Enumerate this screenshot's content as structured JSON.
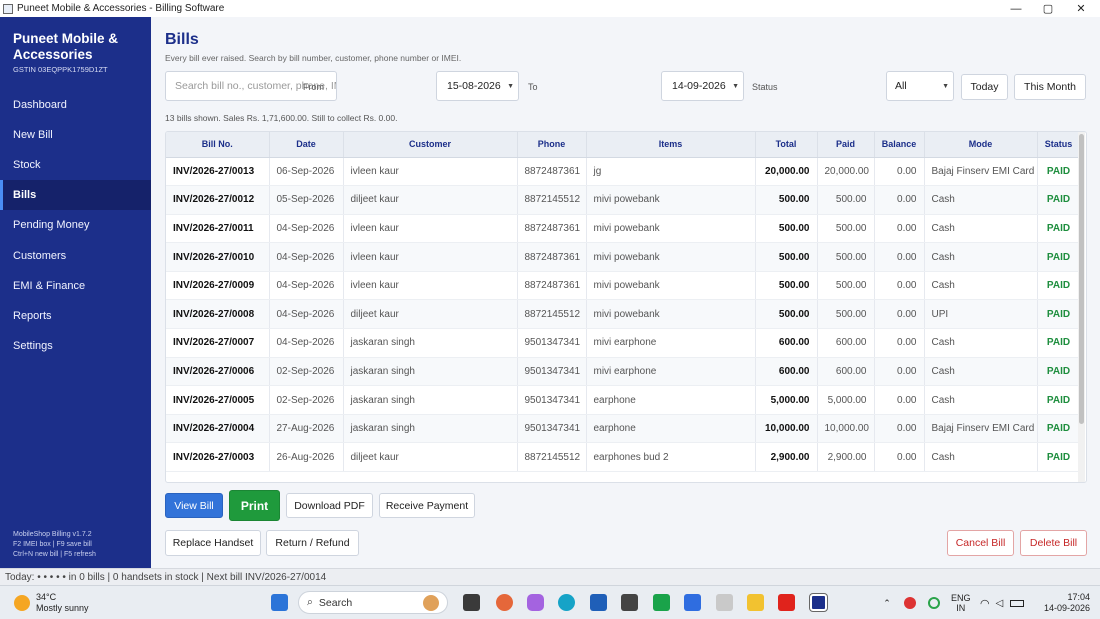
{
  "window": {
    "title": "Puneet Mobile & Accessories  -  Billing Software",
    "controls": {
      "minimize": "—",
      "maximize": "▢",
      "close": "✕"
    }
  },
  "sidebar": {
    "brand": "Puneet Mobile & Accessories",
    "gstin": "GSTIN 03EQPPK1759D1ZT",
    "items": [
      {
        "label": "Dashboard"
      },
      {
        "label": "New Bill"
      },
      {
        "label": "Stock"
      },
      {
        "label": "Bills"
      },
      {
        "label": "Pending Money"
      },
      {
        "label": "Customers"
      },
      {
        "label": "EMI & Finance"
      },
      {
        "label": "Reports"
      },
      {
        "label": "Settings"
      }
    ],
    "active_index": 3,
    "footer": {
      "version": "MobileShop Billing  v1.7.2",
      "hint1": "F2 IMEI box   |   F9 save bill",
      "hint2": "Ctrl+N new bill   |   F5 refresh"
    }
  },
  "page": {
    "title": "Bills",
    "subtitle": "Every bill ever raised. Search by bill number, customer, phone number or IMEI."
  },
  "filters": {
    "search_placeholder": "Search bill no., customer, phone, IMEI...",
    "from_label": "From",
    "from_value": "15-08-2026",
    "to_label": "To",
    "to_value": "14-09-2026",
    "status_label": "Status",
    "status_value": "All",
    "today_button": "Today",
    "this_month_button": "This Month"
  },
  "summary": "13 bills shown.  Sales Rs. 1,71,600.00.  Still to collect Rs. 0.00.",
  "table": {
    "columns": [
      "Bill No.",
      "Date",
      "Customer",
      "Phone",
      "Items",
      "Total",
      "Paid",
      "Balance",
      "Mode",
      "Status"
    ],
    "rows": [
      {
        "bill": "INV/2026-27/0013",
        "date": "06-Sep-2026",
        "customer": "ivleen kaur",
        "phone": "8872487361",
        "items": "jg",
        "total": "20,000.00",
        "paid": "20,000.00",
        "balance": "0.00",
        "mode": "Bajaj Finserv EMI Card",
        "status": "PAID"
      },
      {
        "bill": "INV/2026-27/0012",
        "date": "05-Sep-2026",
        "customer": "diljeet  kaur",
        "phone": "8872145512",
        "items": "mivi powebank",
        "total": "500.00",
        "paid": "500.00",
        "balance": "0.00",
        "mode": "Cash",
        "status": "PAID"
      },
      {
        "bill": "INV/2026-27/0011",
        "date": "04-Sep-2026",
        "customer": "ivleen kaur",
        "phone": "8872487361",
        "items": "mivi powebank",
        "total": "500.00",
        "paid": "500.00",
        "balance": "0.00",
        "mode": "Cash",
        "status": "PAID"
      },
      {
        "bill": "INV/2026-27/0010",
        "date": "04-Sep-2026",
        "customer": "ivleen kaur",
        "phone": "8872487361",
        "items": "mivi powebank",
        "total": "500.00",
        "paid": "500.00",
        "balance": "0.00",
        "mode": "Cash",
        "status": "PAID"
      },
      {
        "bill": "INV/2026-27/0009",
        "date": "04-Sep-2026",
        "customer": "ivleen kaur",
        "phone": "8872487361",
        "items": "mivi powebank",
        "total": "500.00",
        "paid": "500.00",
        "balance": "0.00",
        "mode": "Cash",
        "status": "PAID"
      },
      {
        "bill": "INV/2026-27/0008",
        "date": "04-Sep-2026",
        "customer": "diljeet  kaur",
        "phone": "8872145512",
        "items": "mivi powebank",
        "total": "500.00",
        "paid": "500.00",
        "balance": "0.00",
        "mode": "UPI",
        "status": "PAID"
      },
      {
        "bill": "INV/2026-27/0007",
        "date": "04-Sep-2026",
        "customer": "jaskaran singh",
        "phone": "9501347341",
        "items": "mivi earphone",
        "total": "600.00",
        "paid": "600.00",
        "balance": "0.00",
        "mode": "Cash",
        "status": "PAID"
      },
      {
        "bill": "INV/2026-27/0006",
        "date": "02-Sep-2026",
        "customer": "jaskaran singh",
        "phone": "9501347341",
        "items": "mivi earphone",
        "total": "600.00",
        "paid": "600.00",
        "balance": "0.00",
        "mode": "Cash",
        "status": "PAID"
      },
      {
        "bill": "INV/2026-27/0005",
        "date": "02-Sep-2026",
        "customer": "jaskaran singh",
        "phone": "9501347341",
        "items": "earphone",
        "total": "5,000.00",
        "paid": "5,000.00",
        "balance": "0.00",
        "mode": "Cash",
        "status": "PAID"
      },
      {
        "bill": "INV/2026-27/0004",
        "date": "27-Aug-2026",
        "customer": "jaskaran singh",
        "phone": "9501347341",
        "items": "earphone",
        "total": "10,000.00",
        "paid": "10,000.00",
        "balance": "0.00",
        "mode": "Bajaj Finserv EMI Card",
        "status": "PAID"
      },
      {
        "bill": "INV/2026-27/0003",
        "date": "26-Aug-2026",
        "customer": "diljeet  kaur",
        "phone": "8872145512",
        "items": "earphones bud 2",
        "total": "2,900.00",
        "paid": "2,900.00",
        "balance": "0.00",
        "mode": "Cash",
        "status": "PAID"
      }
    ]
  },
  "actions": {
    "view_bill": "View Bill",
    "print": "Print",
    "download_pdf": "Download PDF",
    "receive_payment": "Receive Payment",
    "replace_handset": "Replace Handset",
    "return_refund": "Return / Refund",
    "cancel_bill": "Cancel Bill",
    "delete_bill": "Delete Bill"
  },
  "statusbar": "Today: • • • • • in 0 bills   |   0 handsets in stock   |   Next bill INV/2026-27/0014",
  "taskbar": {
    "weather_temp": "34°C",
    "weather_desc": "Mostly sunny",
    "search_label": "Search",
    "lang1": "ENG",
    "lang2": "IN",
    "time": "17:04",
    "date": "14-09-2026",
    "colors": {
      "brand": "#1c2f8a",
      "primary_button": "#3273d9",
      "print_button": "#1f9a3c",
      "paid_status": "#1e8e3e",
      "danger": "#c62828"
    }
  }
}
